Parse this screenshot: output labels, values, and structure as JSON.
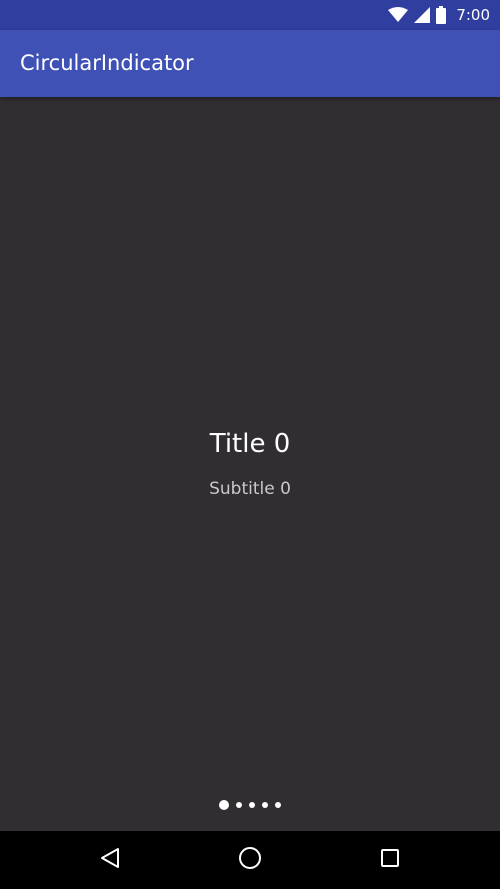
{
  "status_bar": {
    "time": "7:00",
    "icons": [
      "wifi-icon",
      "cell-signal-icon",
      "battery-icon"
    ]
  },
  "app_bar": {
    "title": "CircularIndicator"
  },
  "page": {
    "title": "Title 0",
    "subtitle": "Subtitle 0"
  },
  "indicator": {
    "count": 5,
    "selected_index": 0
  },
  "nav_bar": {
    "icons": [
      "back-icon",
      "home-icon",
      "recents-icon"
    ]
  },
  "colors": {
    "status_bar": "#303f9f",
    "app_bar": "#3f51b5",
    "background": "#302e31",
    "nav_bar": "#000000"
  }
}
